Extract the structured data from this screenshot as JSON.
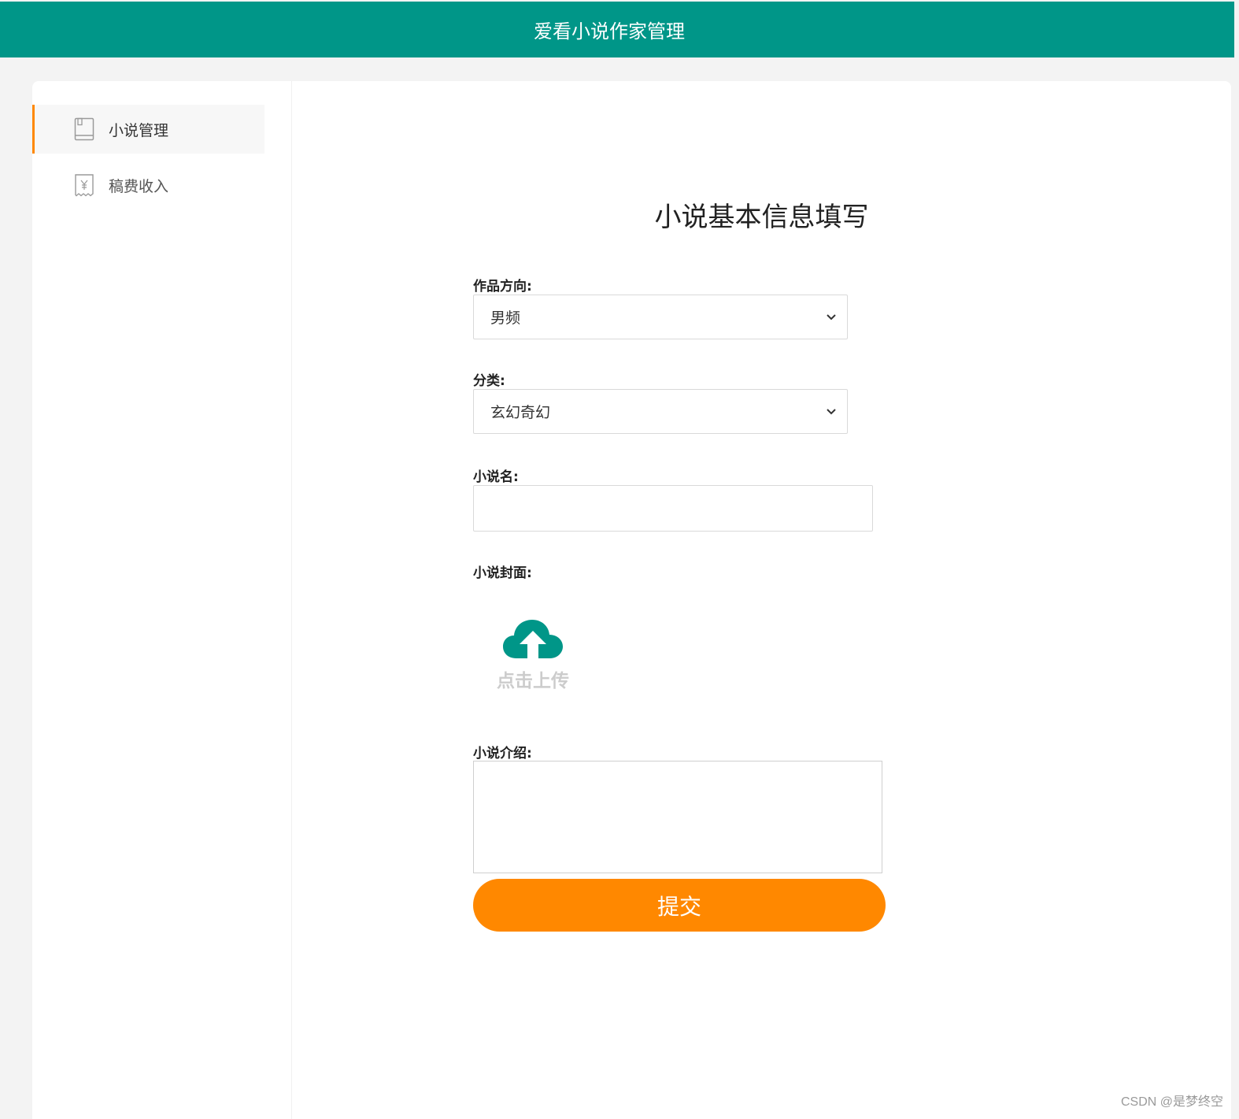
{
  "header": {
    "title": "爱看小说作家管理"
  },
  "sidebar": {
    "items": [
      {
        "label": "小说管理",
        "icon": "book-icon",
        "active": true
      },
      {
        "label": "稿费收入",
        "icon": "receipt-yen-icon",
        "active": false
      }
    ]
  },
  "form": {
    "title": "小说基本信息填写",
    "direction": {
      "label": "作品方向:",
      "value": "男频"
    },
    "category": {
      "label": "分类:",
      "value": "玄幻奇幻"
    },
    "name": {
      "label": "小说名:",
      "value": ""
    },
    "cover": {
      "label": "小说封面:",
      "upload_label": "点击上传",
      "icon": "cloud-upload-icon"
    },
    "intro": {
      "label": "小说介绍:",
      "value": ""
    },
    "submit_label": "提交"
  },
  "colors": {
    "header_bg": "#009688",
    "accent": "#ff8800",
    "upload_icon": "#009688"
  },
  "watermark": "CSDN @是梦终空"
}
